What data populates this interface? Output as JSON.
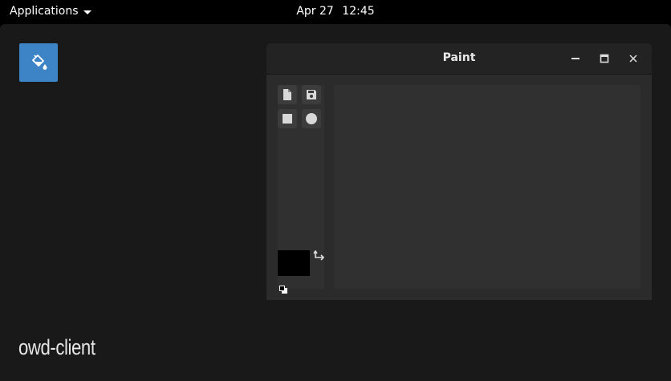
{
  "topbar": {
    "applications_label": "Applications",
    "date": "Apr 27",
    "time": "12:45"
  },
  "desktop": {
    "app_icon": "paint-bucket-icon",
    "client_label": "owd-client",
    "accent_color": "#3c84c6"
  },
  "window": {
    "title": "Paint",
    "controls": [
      "minimize-icon",
      "maximize-icon",
      "close-icon"
    ]
  },
  "toolbar": {
    "tools": [
      "new-document-icon",
      "save-icon",
      "rectangle-icon",
      "circle-icon"
    ],
    "primary_color": "#000000"
  }
}
